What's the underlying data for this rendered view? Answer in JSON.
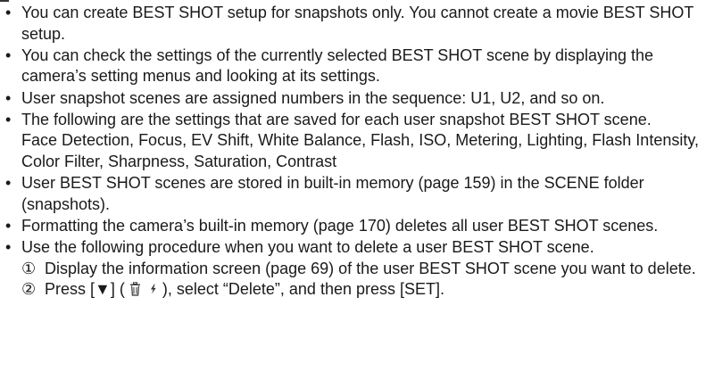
{
  "bullet_glyph": "•",
  "notes": [
    {
      "text": "You can create BEST SHOT setup for snapshots only. You cannot create a movie BEST SHOT setup."
    },
    {
      "text": "You can check the settings of the currently selected BEST SHOT scene by displaying the camera’s setting menus and looking at its settings."
    },
    {
      "text": "User snapshot scenes are assigned numbers in the sequence: U1, U2, and so on."
    },
    {
      "text": "The following are the settings that are saved for each user snapshot BEST SHOT scene.",
      "extra": "Face Detection, Focus, EV Shift, White Balance, Flash, ISO, Metering, Lighting, Flash Intensity, Color Filter, Sharpness, Saturation, Contrast"
    },
    {
      "text": "User BEST SHOT scenes are stored in built-in memory (page 159) in the SCENE folder (snapshots)."
    },
    {
      "text": "Formatting the camera’s built-in memory (page 170) deletes all user BEST SHOT scenes."
    },
    {
      "text": "Use the following procedure when you want to delete a user BEST SHOT scene.",
      "steps": [
        {
          "num": "①",
          "text": "Display the information screen (page 69) of the user BEST SHOT scene you want to delete."
        },
        {
          "num": "②",
          "pre": "Press [▼] (",
          "post": "), select “Delete”, and then press [SET]."
        }
      ]
    }
  ]
}
